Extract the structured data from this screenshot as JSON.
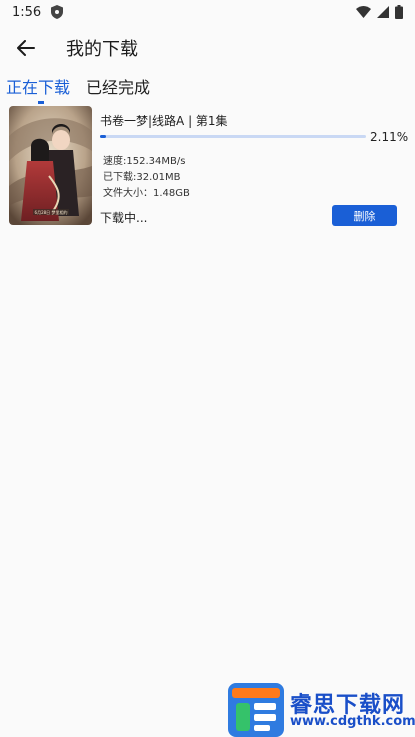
{
  "status_bar": {
    "time": "1:56",
    "icons": [
      "shield-icon",
      "wifi-icon",
      "signal-icon",
      "battery-icon"
    ]
  },
  "app_bar": {
    "back_icon": "arrow-left-icon",
    "title": "我的下载"
  },
  "tabs": [
    {
      "label": "正在下载",
      "active": true
    },
    {
      "label": "已经完成",
      "active": false
    }
  ],
  "downloads": [
    {
      "title": "书卷一梦|线路A | 第1集",
      "progress_percent": 2.11,
      "progress_label": "2.11%",
      "speed": "速度:152.34MB/s",
      "downloaded": "已下载:32.01MB",
      "file_size": "文件大小：1.48GB",
      "status": "下载中...",
      "delete_label": "删除",
      "poster_caption": "6月28日 梦里相约"
    }
  ],
  "watermark": {
    "name": "睿思下载网",
    "url": "www.cdgthk.com"
  },
  "colors": {
    "accent": "#1a5fd6",
    "progress_track": "#c9d8f4",
    "background": "#fafafa"
  }
}
